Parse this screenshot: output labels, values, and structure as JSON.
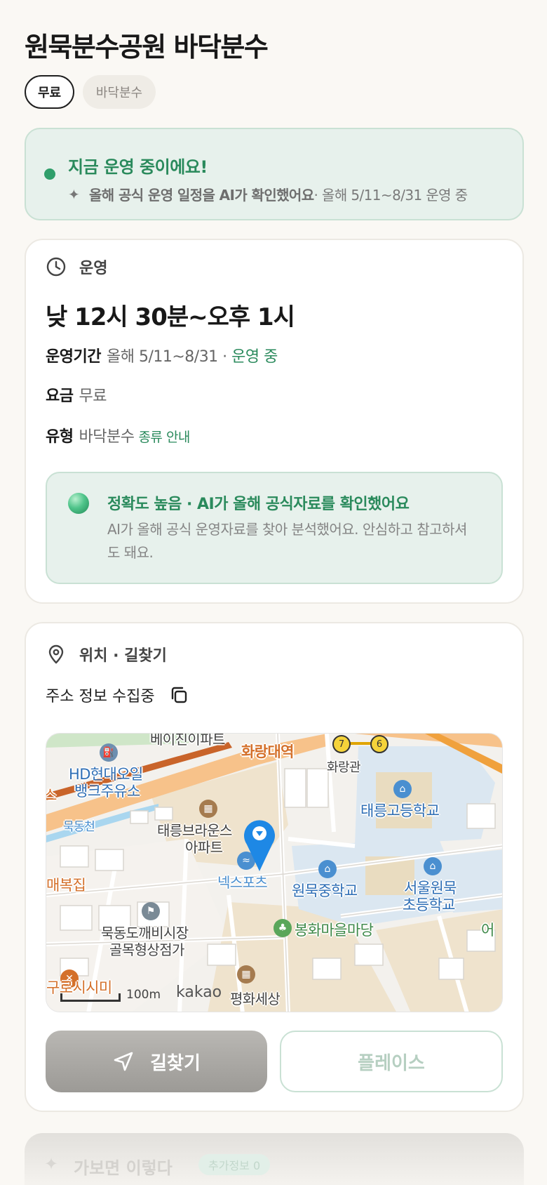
{
  "header": {
    "title": "원묵분수공원 바닥분수",
    "chips": [
      "무료",
      "바닥분수"
    ]
  },
  "status": {
    "title": "지금 운영 중이에요!",
    "sparkle_icon": "sparkle-icon",
    "sub_bold": "올해 공식 운영 일정을 AI가 확인했어요",
    "sub_rest": " · 올해 5/11~8/31 운영 중",
    "color": "#2a8a5c"
  },
  "operation": {
    "heading": "운영",
    "time": "낮 12시 30분~오후 1시",
    "period_label": "운영기간",
    "period_value": "올해 5/11~8/31 · ",
    "period_status": "운영 중",
    "fee_label": "요금",
    "fee_value": "무료",
    "type_label": "유형",
    "type_value": "바닥분수",
    "type_link": "종류 안내",
    "ai": {
      "title": "정확도 높음 · AI가 올해 공식자료를 확인했어요",
      "desc": "AI가 올해 공식 운영자료를 찾아 분석했어요. 안심하고 참고하셔도 돼요."
    }
  },
  "location": {
    "heading": "위치 · 길찾기",
    "address": "주소 정보 수집중",
    "map": {
      "labels": {
        "top_cut": "베이진이파트",
        "station": "화랑대역",
        "hwarang": "화랑관",
        "oil": "HD현대오일",
        "oil2": "뱅크주유소",
        "stream": "묵동천",
        "apt1": "태릉브라운스",
        "apt2": "아파트",
        "school1": "태릉고등학교",
        "nexsports": "넥스포츠",
        "school2": "원묵중학교",
        "school3a": "서울원묵",
        "school3b": "초등학교",
        "maebok": "매복집",
        "market1": "묵동도깨비시장",
        "market2": "골목형상점가",
        "park": "봉화마을마당",
        "bottom_left": "구로시시미",
        "bottom_mid": "평화세상",
        "right_cut": "어",
        "left_cut": "스",
        "line7": "7",
        "line6": "6"
      },
      "scale": "100m",
      "logo": "kakao"
    },
    "route_button": "길찾기",
    "place_button": "플레이스"
  },
  "next_section": {
    "title": "가보면 이렇다",
    "badge": "추가정보 0"
  }
}
